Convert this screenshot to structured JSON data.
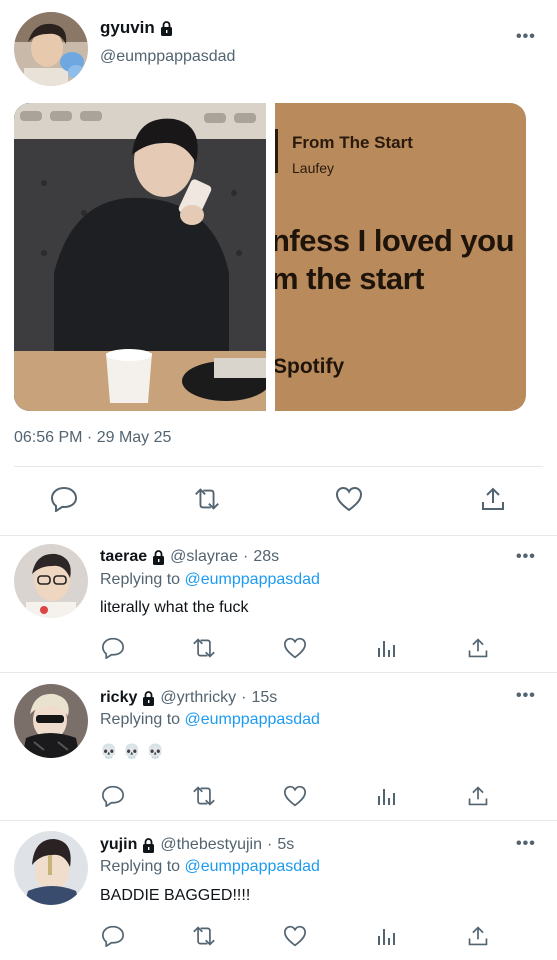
{
  "main_tweet": {
    "display_name": "gyuvin",
    "handle": "@eumppappasdad",
    "protected": true,
    "media": {
      "song_card": {
        "title": "From The Start",
        "artist": "Laufey",
        "lyric_line_1": "nfess I loved you",
        "lyric_line_2": "m the start",
        "brand": "Spotify"
      }
    },
    "timestamp": "06:56 PM · 29 May 25",
    "actions": [
      "reply-icon",
      "retweet-icon",
      "like-icon",
      "share-icon"
    ]
  },
  "replies": [
    {
      "display_name": "taerae",
      "handle": "@slayrae",
      "time": "28s",
      "replying_prefix": "Replying to",
      "replying_to": "@eumppappasdad",
      "text": "literally what the fuck"
    },
    {
      "display_name": "ricky",
      "handle": "@yrthricky",
      "time": "15s",
      "replying_prefix": "Replying to",
      "replying_to": "@eumppappasdad",
      "text": "💀💀💀"
    },
    {
      "display_name": "yujin",
      "handle": "@thebestyujin",
      "time": "5s",
      "replying_prefix": "Replying to",
      "replying_to": "@eumppappasdad",
      "text": "BADDIE BAGGED!!!!"
    }
  ],
  "reply_actions": [
    "reply-icon",
    "retweet-icon",
    "like-icon",
    "analytics-icon",
    "share-icon"
  ],
  "colors": {
    "link": "#1d9bf0",
    "secondary_text": "#536471",
    "primary_text": "#0f1419",
    "divider": "#e6e9ec",
    "song_card_bg": "#b98a5c"
  }
}
